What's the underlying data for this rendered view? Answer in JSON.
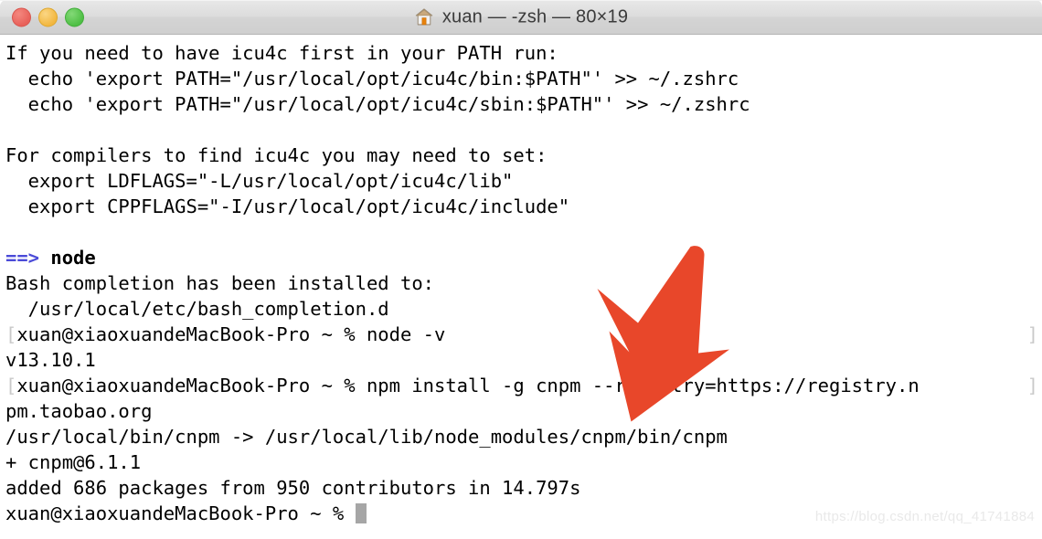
{
  "window": {
    "title": "xuan — -zsh — 80×19",
    "icon": "home-icon",
    "traffic_lights": [
      {
        "name": "close",
        "label": "Close",
        "color": "#e8615a"
      },
      {
        "name": "minimize",
        "label": "Minimize",
        "color": "#f2b740"
      },
      {
        "name": "maximize",
        "label": "Maximize",
        "color": "#4fbf45"
      }
    ]
  },
  "colors": {
    "titlebar_bg": "#dcdcdc",
    "terminal_bg": "#ffffff",
    "terminal_fg": "#000000",
    "brew_arrow": "#4b4bd8",
    "annotation_arrow": "#e8472a",
    "wrap_mark": "#c9c9c9",
    "cursor": "#a6a6a6",
    "watermark": "#e9e9e9"
  },
  "terminal": {
    "cols": 80,
    "rows": 19,
    "shell": "-zsh",
    "user_host": "xuan@xiaoxuandeMacBook-Pro",
    "prompt_symbol": "%",
    "cwd": "~",
    "lines": [
      {
        "id": "l01",
        "text": "If you need to have icu4c first in your PATH run:"
      },
      {
        "id": "l02",
        "text": "  echo 'export PATH=\"/usr/local/opt/icu4c/bin:$PATH\"' >> ~/.zshrc"
      },
      {
        "id": "l03",
        "text": "  echo 'export PATH=\"/usr/local/opt/icu4c/sbin:$PATH\"' >> ~/.zshrc"
      },
      {
        "id": "l04",
        "text": ""
      },
      {
        "id": "l05",
        "text": "For compilers to find icu4c you may need to set:"
      },
      {
        "id": "l06",
        "text": "  export LDFLAGS=\"-L/usr/local/opt/icu4c/lib\""
      },
      {
        "id": "l07",
        "text": "  export CPPFLAGS=\"-I/usr/local/opt/icu4c/include\""
      },
      {
        "id": "l08",
        "text": ""
      },
      {
        "id": "l09",
        "prefix": "==> ",
        "prefix_style": "arrow",
        "text": "node",
        "text_style": "bold"
      },
      {
        "id": "l10",
        "text": "Bash completion has been installed to:"
      },
      {
        "id": "l11",
        "text": "  /usr/local/etc/bash_completion.d"
      },
      {
        "id": "l12",
        "lead_mark": "[",
        "text": "xuan@xiaoxuandeMacBook-Pro ~ % node -v",
        "trail_mark": "]"
      },
      {
        "id": "l13",
        "text": "v13.10.1"
      },
      {
        "id": "l14",
        "lead_mark": "[",
        "text": "xuan@xiaoxuandeMacBook-Pro ~ % npm install -g cnpm --registry=https://registry.n",
        "trail_mark": "]"
      },
      {
        "id": "l15",
        "text": "pm.taobao.org"
      },
      {
        "id": "l16",
        "text": "/usr/local/bin/cnpm -> /usr/local/lib/node_modules/cnpm/bin/cnpm"
      },
      {
        "id": "l17",
        "text": "+ cnpm@6.1.1"
      },
      {
        "id": "l18",
        "text": "added 686 packages from 950 contributors in 14.797s"
      },
      {
        "id": "l19",
        "text": "xuan@xiaoxuandeMacBook-Pro ~ % ",
        "cursor": true
      }
    ]
  },
  "annotation": {
    "type": "arrow",
    "direction": "down-left",
    "points_at": "cnpm",
    "color": "#e8472a"
  },
  "watermark": {
    "text": "https://blog.csdn.net/qq_41741884"
  }
}
